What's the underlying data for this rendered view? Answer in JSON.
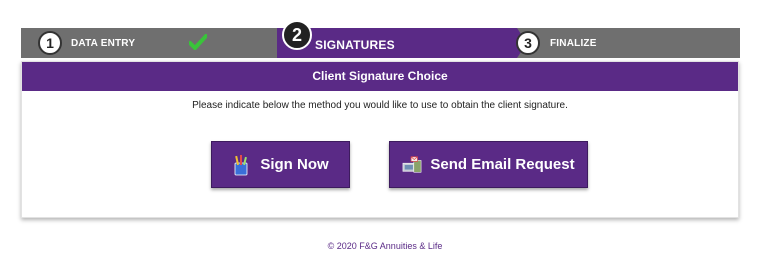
{
  "stepper": {
    "steps": [
      {
        "number": "1",
        "label": "DATA ENTRY",
        "state": "complete"
      },
      {
        "number": "2",
        "label": "SIGNATURES",
        "state": "active"
      },
      {
        "number": "3",
        "label": "FINALIZE",
        "state": "pending"
      }
    ]
  },
  "panel": {
    "title": "Client Signature Choice",
    "instructions": "Please indicate below the method you would like to use to obtain the client signature."
  },
  "actions": {
    "sign_now_label": "Sign Now",
    "send_email_label": "Send Email Request"
  },
  "footer": {
    "copyright": "© 2020 F&G Annuities & Life"
  },
  "colors": {
    "brand_purple": "#5a2a86",
    "stepper_gray": "#6f6f6f",
    "check_green": "#39c43a"
  },
  "icons": {
    "step_complete": "checkmark-icon",
    "sign_now": "pen-cup-icon",
    "send_email": "mail-computer-icon"
  }
}
